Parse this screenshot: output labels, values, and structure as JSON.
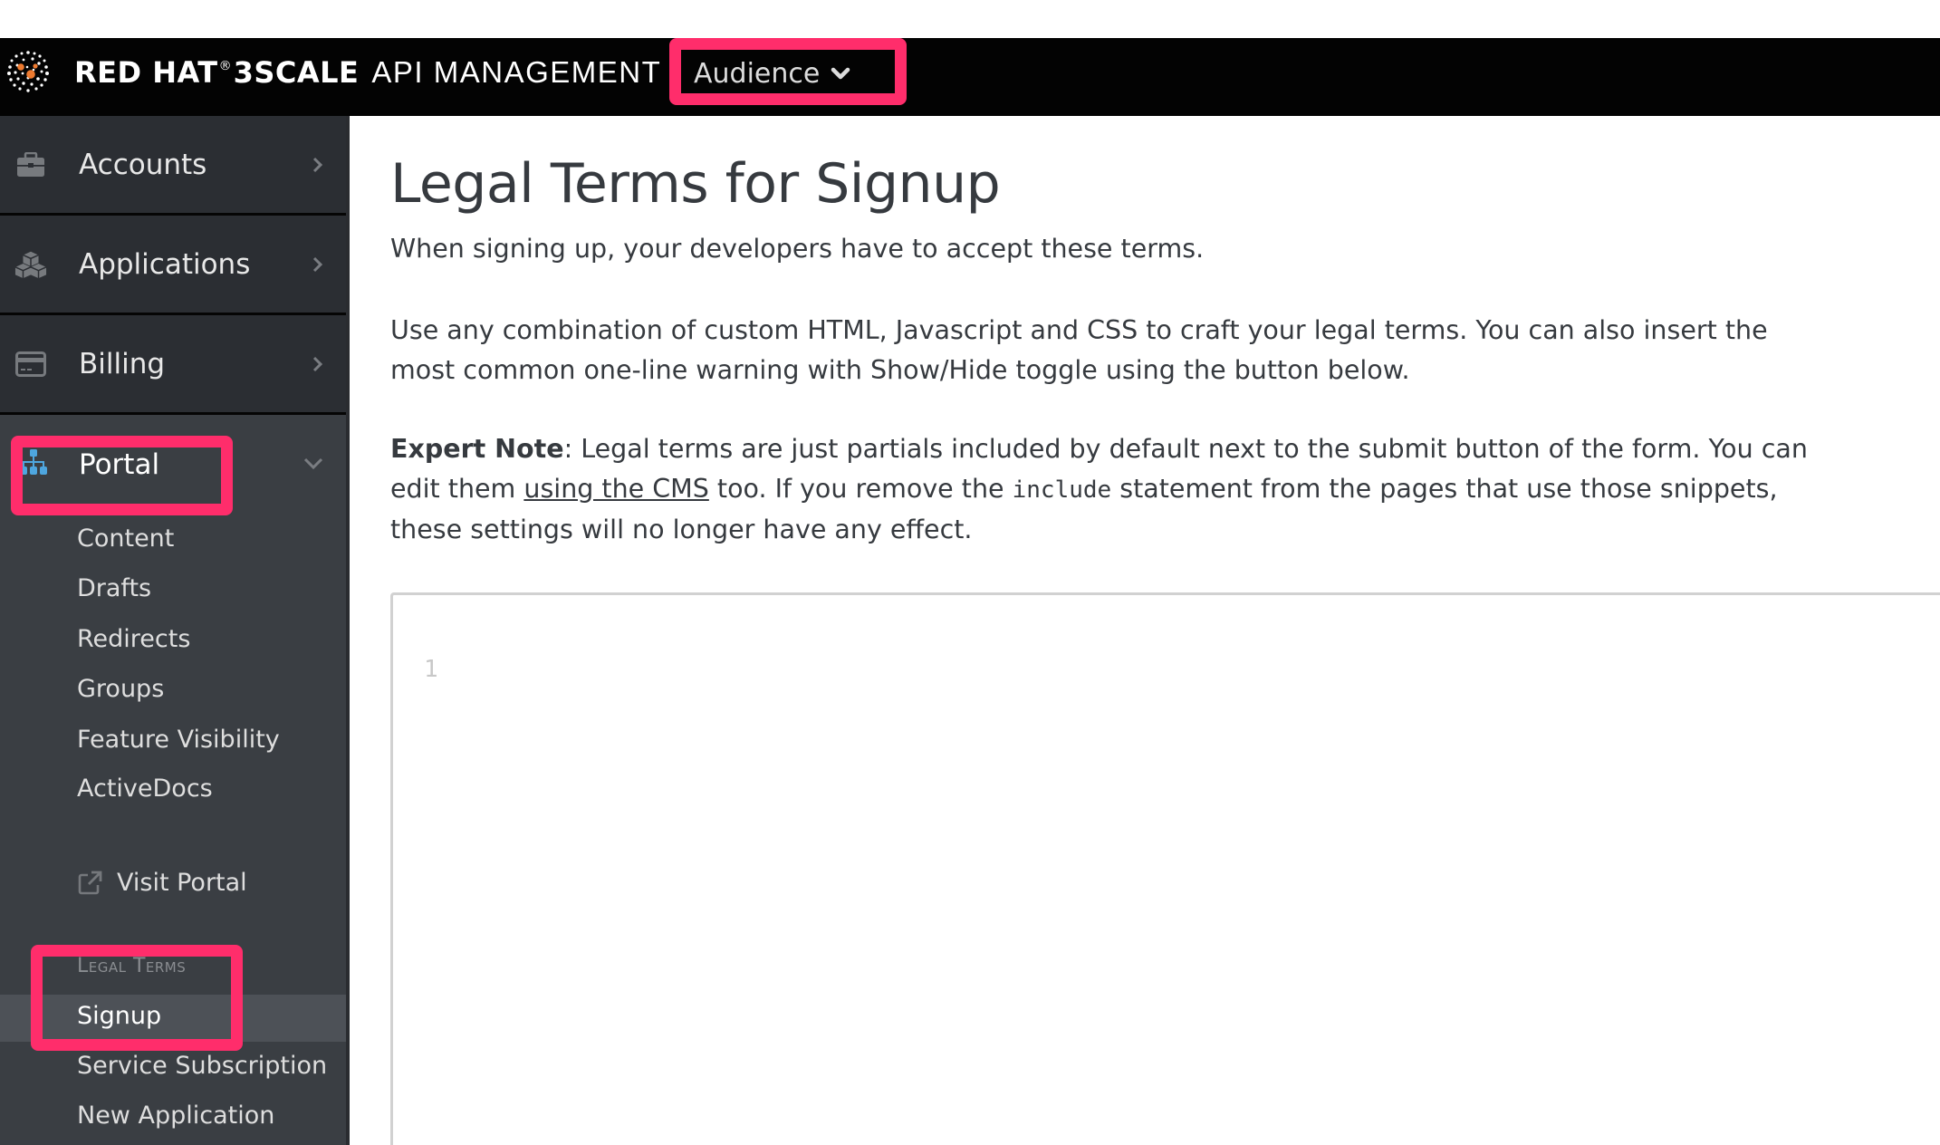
{
  "header": {
    "brand_bold": "RED HAT",
    "brand_registered": "®",
    "brand_product": "3SCALE",
    "brand_light": "API MANAGEMENT",
    "context_switcher_label": "Audience",
    "logo_icon": "red-hat-3scale-logo",
    "chevron_icon": "chevron-down-icon"
  },
  "sidebar": {
    "top_items": [
      {
        "label": "Accounts",
        "icon": "briefcase-icon"
      },
      {
        "label": "Applications",
        "icon": "cubes-icon"
      },
      {
        "label": "Billing",
        "icon": "credit-card-icon"
      }
    ],
    "portal": {
      "label": "Portal",
      "icon": "sitemap-icon",
      "expanded": true,
      "sub_items": [
        "Content",
        "Drafts",
        "Redirects",
        "Groups",
        "Feature Visibility",
        "ActiveDocs"
      ],
      "visit_portal": {
        "label": "Visit Portal",
        "icon": "external-link-icon"
      },
      "legal_terms": {
        "heading": "Legal Terms",
        "items": [
          "Signup",
          "Service Subscription",
          "New Application"
        ],
        "selected": "Signup"
      }
    }
  },
  "main": {
    "title": "Legal Terms for Signup",
    "intro": "When signing up, your developers have to accept these terms.",
    "instructions": "Use any combination of custom HTML, Javascript and CSS to craft your legal terms. You can also insert the most common one-line warning with Show/Hide toggle using the button below.",
    "expert_note": {
      "label": "Expert Note",
      "text_before_link": ": Legal terms are just partials included by default next to the submit button of the form. You can edit them ",
      "link_text": "using the CMS",
      "text_after_link": " too. If you remove the ",
      "code": "include",
      "text_end": " statement from the pages that use those snippets, these settings will no longer have any effect."
    },
    "editor": {
      "line_numbers": [
        "1"
      ],
      "content": ""
    }
  },
  "annotations": {
    "highlight_color": "#ff2d6b"
  }
}
